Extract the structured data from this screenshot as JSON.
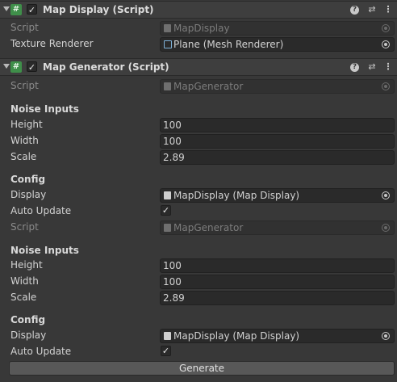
{
  "map_display": {
    "title": "Map Display (Script)",
    "script_label": "Script",
    "script_value": "MapDisplay",
    "texture_renderer_label": "Texture Renderer",
    "texture_renderer_value": "Plane (Mesh Renderer)"
  },
  "map_generator": {
    "title": "Map Generator (Script)",
    "script_label": "Script",
    "script_value": "MapGenerator",
    "noise_inputs_label": "Noise Inputs",
    "height_label": "Height",
    "height_value": "100",
    "width_label": "Width",
    "width_value": "100",
    "scale_label": "Scale",
    "scale_value": "2.89",
    "config_label": "Config",
    "display_label": "Display",
    "display_value": "MapDisplay (Map Display)",
    "auto_update_label": "Auto Update",
    "script2_label": "Script",
    "script2_value": "MapGenerator",
    "noise_inputs2_label": "Noise Inputs",
    "height2_label": "Height",
    "height2_value": "100",
    "width2_label": "Width",
    "width2_value": "100",
    "scale2_label": "Scale",
    "scale2_value": "2.89",
    "config2_label": "Config",
    "display2_label": "Display",
    "display2_value": "MapDisplay (Map Display)",
    "auto_update2_label": "Auto Update",
    "generate_label": "Generate"
  },
  "icons": {
    "script": "#",
    "check": "✓",
    "help": "?",
    "presets": "⇄",
    "menu": "⋮"
  }
}
